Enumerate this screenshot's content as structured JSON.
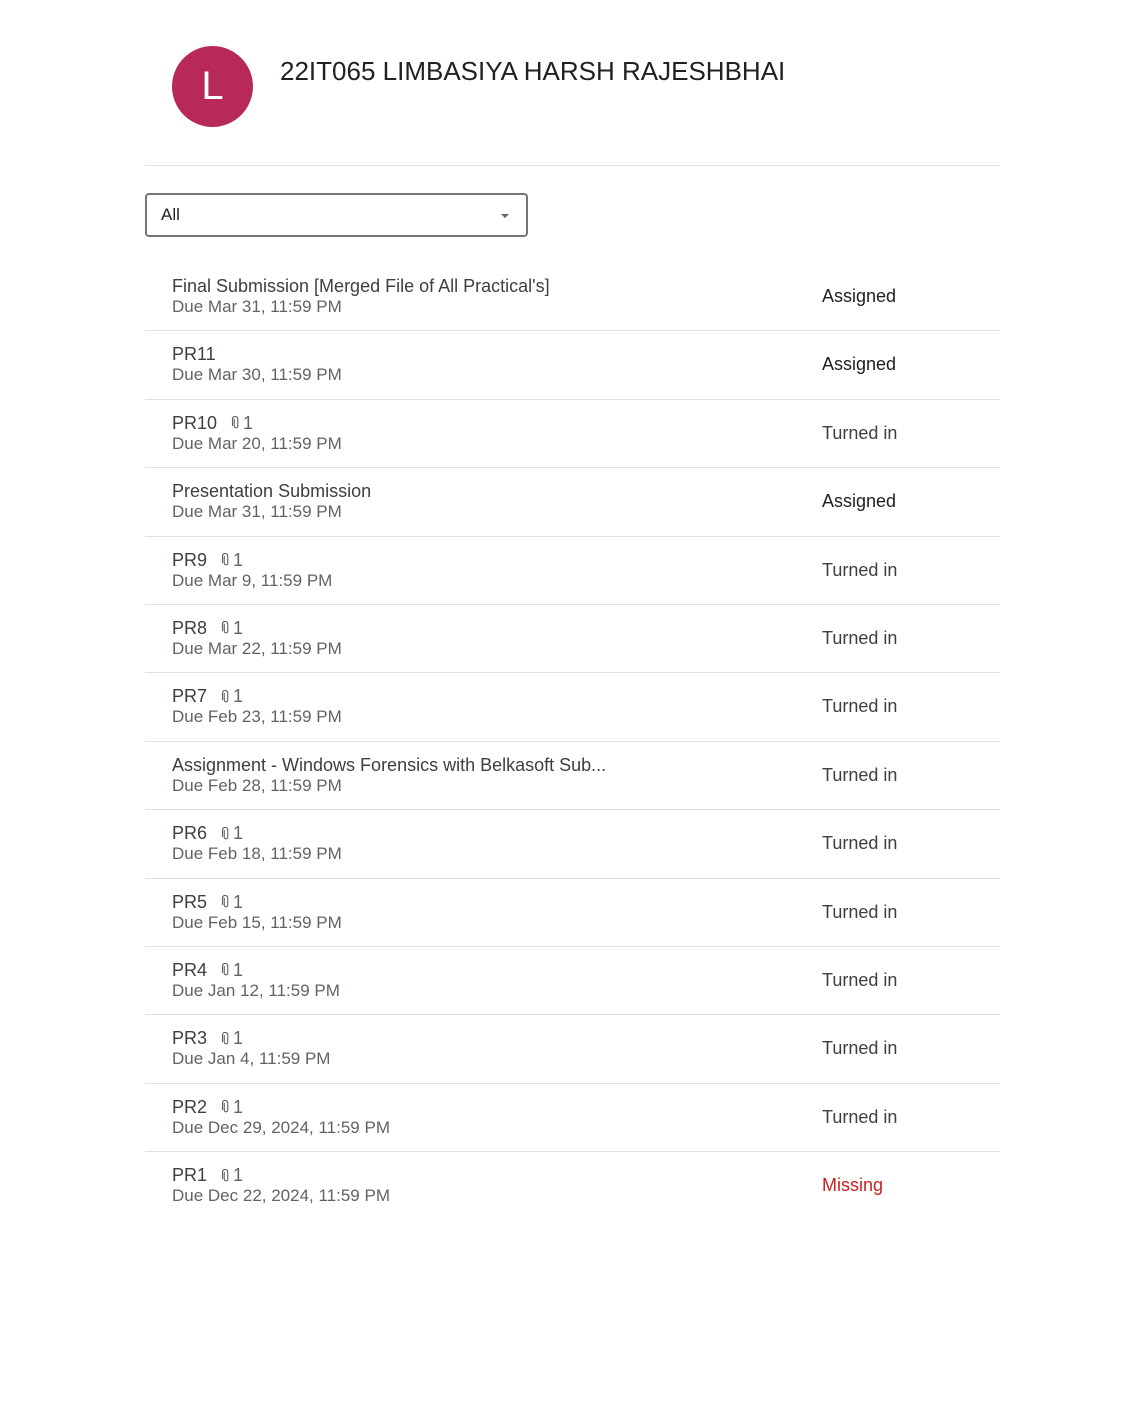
{
  "student": {
    "avatar_letter": "L",
    "avatar_color": "#b7295a",
    "name": "22IT065 LIMBASIYA HARSH RAJESHBHAI"
  },
  "filter": {
    "selected": "All"
  },
  "status_colors": {
    "Assigned": "#202124",
    "Turned in": "#3c4043",
    "Missing": "#c5221f"
  },
  "assignments": [
    {
      "title": "Final Submission [Merged File of All Practical's]",
      "attachments": "",
      "due": "Due Mar 31, 11:59 PM",
      "status": "Assigned"
    },
    {
      "title": "PR11",
      "attachments": "",
      "due": "Due Mar 30, 11:59 PM",
      "status": "Assigned"
    },
    {
      "title": "PR10",
      "attachments": "1",
      "due": "Due Mar 20, 11:59 PM",
      "status": "Turned in"
    },
    {
      "title": "Presentation Submission",
      "attachments": "",
      "due": "Due Mar 31, 11:59 PM",
      "status": "Assigned"
    },
    {
      "title": "PR9",
      "attachments": "1",
      "due": "Due Mar 9, 11:59 PM",
      "status": "Turned in"
    },
    {
      "title": "PR8",
      "attachments": "1",
      "due": "Due Mar 22, 11:59 PM",
      "status": "Turned in"
    },
    {
      "title": "PR7",
      "attachments": "1",
      "due": "Due Feb 23, 11:59 PM",
      "status": "Turned in"
    },
    {
      "title": "Assignment - Windows Forensics with Belkasoft Sub...",
      "attachments": "",
      "due": "Due Feb 28, 11:59 PM",
      "status": "Turned in"
    },
    {
      "title": "PR6",
      "attachments": "1",
      "due": "Due Feb 18, 11:59 PM",
      "status": "Turned in"
    },
    {
      "title": "PR5",
      "attachments": "1",
      "due": "Due Feb 15, 11:59 PM",
      "status": "Turned in"
    },
    {
      "title": "PR4",
      "attachments": "1",
      "due": "Due Jan 12, 11:59 PM",
      "status": "Turned in"
    },
    {
      "title": "PR3",
      "attachments": "1",
      "due": "Due Jan 4, 11:59 PM",
      "status": "Turned in"
    },
    {
      "title": "PR2",
      "attachments": "1",
      "due": "Due Dec 29, 2024, 11:59 PM",
      "status": "Turned in"
    },
    {
      "title": "PR1",
      "attachments": "1",
      "due": "Due Dec 22, 2024, 11:59 PM",
      "status": "Missing"
    }
  ]
}
